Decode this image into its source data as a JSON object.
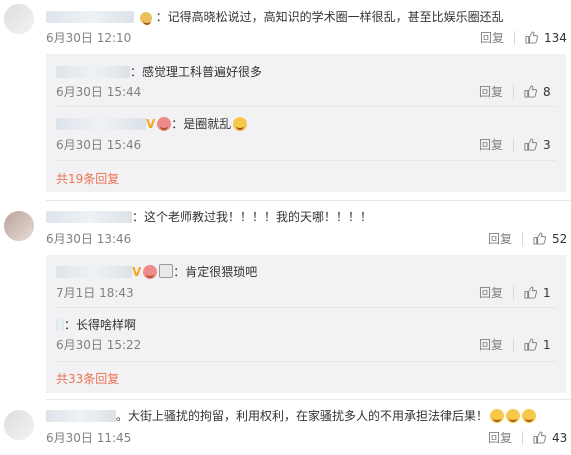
{
  "reply_label": "回复",
  "comments": [
    {
      "text": "：记得高晓松说过，高知识的学术圈一样很乱，甚至比娱乐圈还乱",
      "time": "6月30日 12:10",
      "likes": "134"
    },
    {
      "text": "：这个老师教过我！！！！我的天哪！！！！",
      "time": "6月30日 13:46",
      "likes": "52"
    },
    {
      "text": "。大街上骚扰的拘留，利用权利，在家骚扰多人的不用承担法律后果！",
      "time": "6月30日 11:45",
      "likes": "43"
    }
  ],
  "replies_a": [
    {
      "text": "：感觉理工科普遍好很多",
      "time": "6月30日 15:44",
      "likes": "8"
    },
    {
      "text": "：是圈就乱",
      "time": "6月30日 15:46",
      "likes": "3"
    }
  ],
  "replies_b": [
    {
      "text": "：肯定很猥琐吧",
      "time": "7月1日 18:43",
      "likes": "1"
    },
    {
      "text": "：长得啥样啊",
      "time": "6月30日 15:22",
      "likes": "1"
    }
  ],
  "more_a": "共19条回复",
  "more_b": "共33条回复",
  "colors": {
    "accent": "#eb7350",
    "meta": "#808080",
    "subbg": "#f2f2f5"
  },
  "icons": {
    "like": "thumbs-up-icon",
    "vip": "v-badge-icon",
    "emoji": "smile-emoji-icon"
  }
}
